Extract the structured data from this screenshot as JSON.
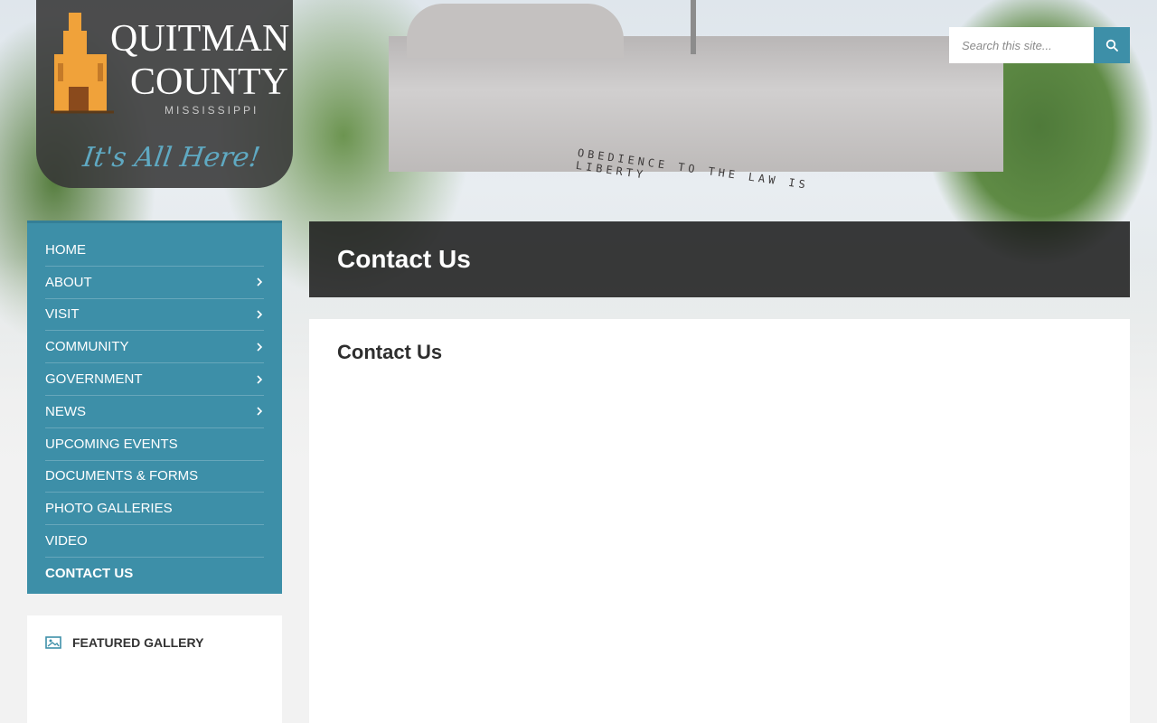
{
  "logo": {
    "title_line1": "QUITMAN",
    "title_line2": "COUNTY",
    "state": "MISSISSIPPI",
    "tagline": "It's All Here!"
  },
  "background": {
    "frieze_text": "OBEDIENCE TO THE LAW IS LIBERTY"
  },
  "search": {
    "placeholder": "Search this site...",
    "icon": "search-icon"
  },
  "nav": {
    "items": [
      {
        "label": "HOME",
        "has_submenu": false,
        "active": false
      },
      {
        "label": "ABOUT",
        "has_submenu": true,
        "active": false
      },
      {
        "label": "VISIT",
        "has_submenu": true,
        "active": false
      },
      {
        "label": "COMMUNITY",
        "has_submenu": true,
        "active": false
      },
      {
        "label": "GOVERNMENT",
        "has_submenu": true,
        "active": false
      },
      {
        "label": "NEWS",
        "has_submenu": true,
        "active": false
      },
      {
        "label": "UPCOMING EVENTS",
        "has_submenu": false,
        "active": false
      },
      {
        "label": "DOCUMENTS & FORMS",
        "has_submenu": false,
        "active": false
      },
      {
        "label": "PHOTO GALLERIES",
        "has_submenu": false,
        "active": false
      },
      {
        "label": "VIDEO",
        "has_submenu": false,
        "active": false
      },
      {
        "label": "CONTACT US",
        "has_submenu": false,
        "active": true
      }
    ]
  },
  "gallery": {
    "heading": "FEATURED GALLERY",
    "icon": "image-icon"
  },
  "page": {
    "title": "Contact Us",
    "content_heading": "Contact Us"
  },
  "colors": {
    "accent": "#3d8fa8",
    "title_bar": "#161616",
    "tagline": "#5fa9c2",
    "logo_orange": "#f0a23a"
  }
}
